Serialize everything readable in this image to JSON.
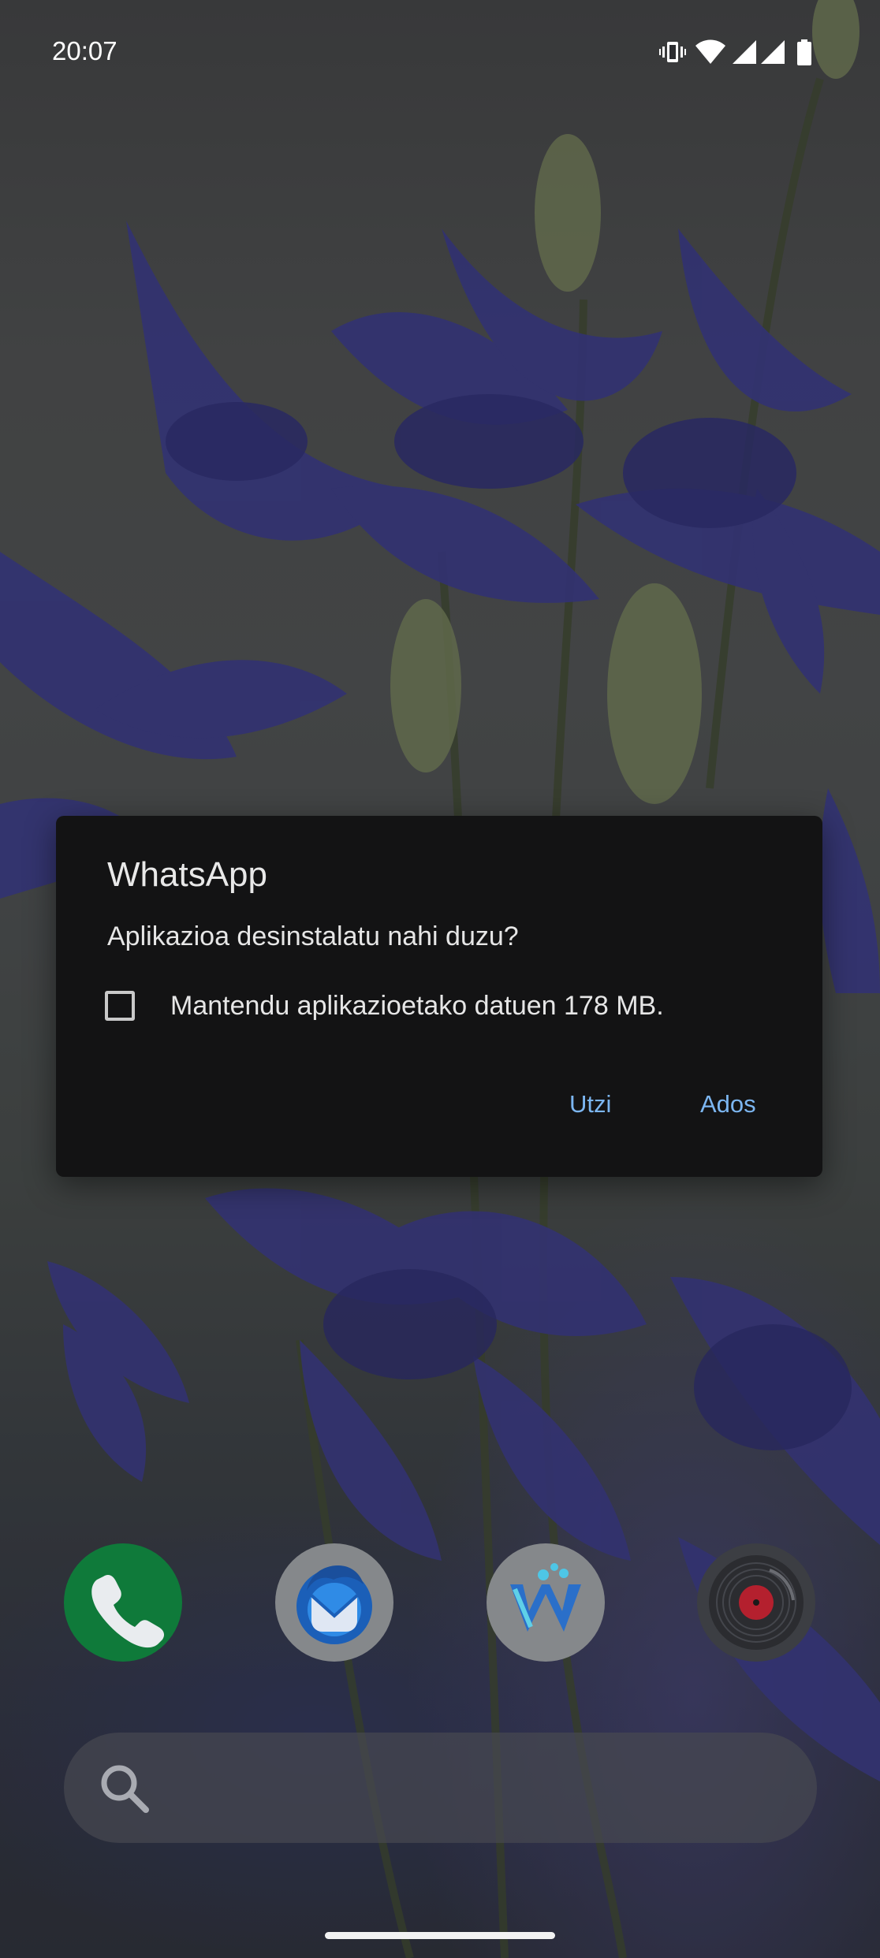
{
  "status_bar": {
    "time": "20:07",
    "icons": [
      "vibrate-icon",
      "wifi-icon",
      "cell-signal-icon",
      "cell-signal-icon",
      "battery-icon"
    ]
  },
  "dialog": {
    "title": "WhatsApp",
    "message": "Aplikazioa desinstalatu nahi duzu?",
    "checkbox_label": "Mantendu aplikazioetako datuen 178 MB.",
    "checkbox_checked": false,
    "cancel_label": "Utzi",
    "ok_label": "Ados",
    "accent_color": "#7cb6f1"
  },
  "dock": {
    "apps": [
      {
        "icon": "phone-icon",
        "color": "#0f7a3a"
      },
      {
        "icon": "thunderbird-icon",
        "color": "#85888b"
      },
      {
        "icon": "wikipedia-icon",
        "color": "#85888b"
      },
      {
        "icon": "music-player-icon",
        "color": "#3c3e43"
      }
    ]
  },
  "search": {
    "placeholder": "",
    "value": "",
    "icon": "search-icon"
  }
}
